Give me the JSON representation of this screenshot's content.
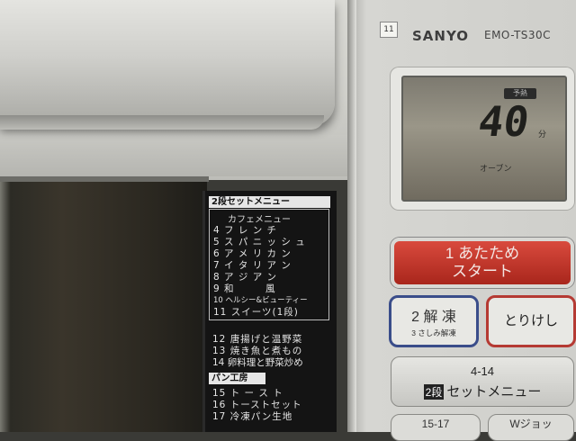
{
  "device": {
    "tag": "11",
    "brand": "SANYO",
    "model": "EMO-TS30C"
  },
  "display": {
    "mode_label": "予熱",
    "value": "40",
    "unit": "分",
    "mode": "オーブン"
  },
  "menu": {
    "header": "2段セットメニュー",
    "cafe_header": "カフェメニュー",
    "cafe_items": [
      "4 フ レ ン チ",
      "5 ス パ ニ ッ シ ュ",
      "6 ア メ リ カ ン",
      "7 イ タ リ ア ン",
      "8 ア ジ ア ン",
      "9 和　　　風",
      "10 ヘルシー&ビューティー",
      "11 スイーツ(1段)"
    ],
    "other_items": [
      "12 唐揚げと温野菜",
      "13 焼き魚と煮もの",
      "14 卵料理と野菜炒め"
    ],
    "bakery_header": "パン工房",
    "bakery_items": [
      "15 ト ー ス ト",
      "16 トーストセット",
      "17 冷凍パン生地"
    ]
  },
  "buttons": {
    "start_line1": "1 あたため",
    "start_line2": "スタート",
    "defrost_main": "2 解 凍",
    "defrost_sub": "3 さしみ解凍",
    "cancel": "とりけし",
    "set_range": "4-14",
    "set_badge": "2段",
    "set_label": "セットメニュー",
    "bottom_left": "15-17",
    "bottom_right": "Wジョッ"
  },
  "colors": {
    "start": "#c2342a",
    "defrost_border": "#3a4d8a",
    "cancel_border": "#b53a33"
  }
}
